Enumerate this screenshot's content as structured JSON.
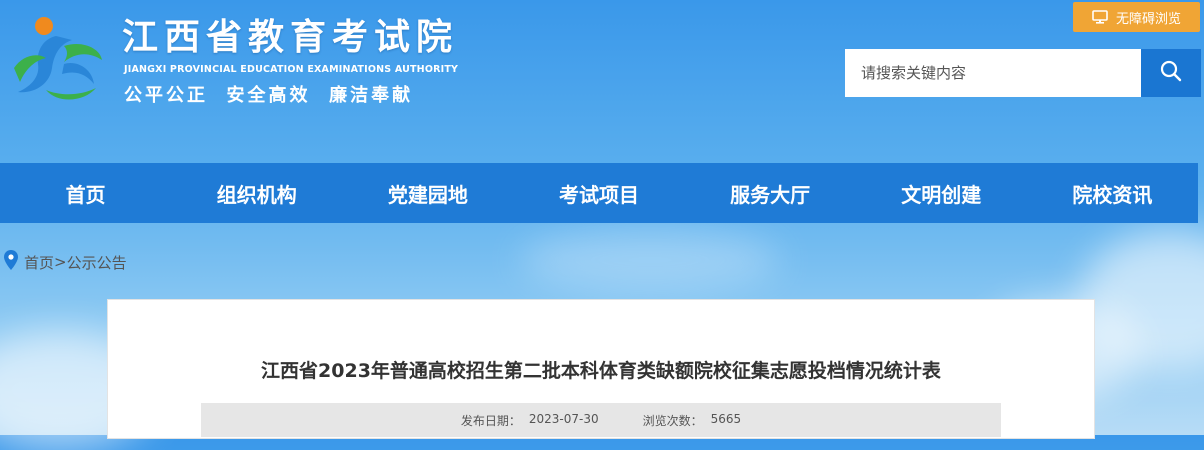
{
  "header": {
    "site_title": "江西省教育考试院",
    "site_subtitle": "JIANGXI PROVINCIAL EDUCATION EXAMINATIONS AUTHORITY",
    "slogan": "公平公正  安全高效  廉洁奉献",
    "logo_icon": "jiangxi-exam-authority-logo"
  },
  "accessibility": {
    "label": "无障碍浏览",
    "icon": "monitor-icon"
  },
  "search": {
    "placeholder": "请搜索关键内容",
    "value": "",
    "icon": "search-icon"
  },
  "nav": {
    "items": [
      {
        "label": "首页"
      },
      {
        "label": "组织机构"
      },
      {
        "label": "党建园地"
      },
      {
        "label": "考试项目"
      },
      {
        "label": "服务大厅"
      },
      {
        "label": "文明创建"
      },
      {
        "label": "院校资讯"
      }
    ]
  },
  "breadcrumb": {
    "icon": "location-pin-icon",
    "home": "首页",
    "separator": ">",
    "current": "公示公告"
  },
  "article": {
    "title": "江西省2023年普通高校招生第二批本科体育类缺额院校征集志愿投档情况统计表",
    "publish_label": "发布日期：",
    "publish_date": "2023-07-30",
    "views_label": "浏览次数：",
    "views": "5665"
  },
  "colors": {
    "nav_bg": "#1f7bd6",
    "accessibility_bg": "#f0a535",
    "search_button_bg": "#1a76d2",
    "logo_orange": "#f08a1e",
    "logo_blue": "#2a86d8",
    "logo_green": "#3cb04a"
  }
}
